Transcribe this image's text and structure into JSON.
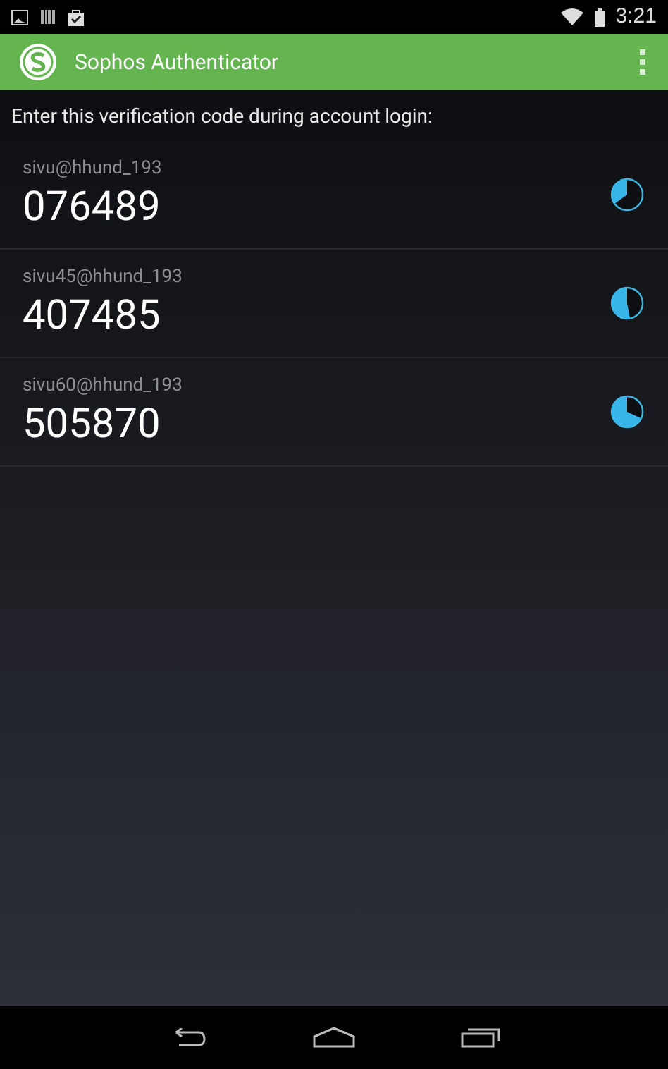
{
  "status_bar": {
    "time": "3:21"
  },
  "app_bar": {
    "title": "Sophos Authenticator"
  },
  "instruction": "Enter this verification code during account login:",
  "accounts": [
    {
      "name": "sivu@hhund_193",
      "code": "076489"
    },
    {
      "name": "sivu45@hhund_193",
      "code": "407485"
    },
    {
      "name": "sivu60@hhund_193",
      "code": "505870"
    }
  ]
}
